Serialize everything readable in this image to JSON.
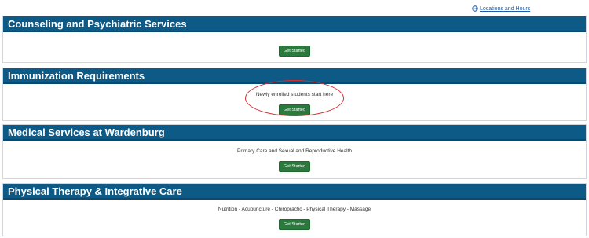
{
  "top_link": {
    "label": "Locations and Hours",
    "icon": "globe-icon"
  },
  "panels": [
    {
      "title": "Counseling and Psychiatric Services",
      "description": "",
      "button": "Get Started"
    },
    {
      "title": "Immunization Requirements",
      "description": "Newly enrolled students start here",
      "button": "Get Started"
    },
    {
      "title": "Medical Services at Wardenburg",
      "description": "Primary Care and Sexual and Reproductive Health",
      "button": "Get Started"
    },
    {
      "title": "Physical Therapy & Integrative Care",
      "description": "Nutrition - Acupuncture - Chiropractic - Physical Therapy - Massage",
      "button": "Get Started"
    }
  ],
  "colors": {
    "header": "#0e5a87",
    "button": "#2b7a3d",
    "annotation": "#d32f2f",
    "link": "#1f5aa6"
  }
}
